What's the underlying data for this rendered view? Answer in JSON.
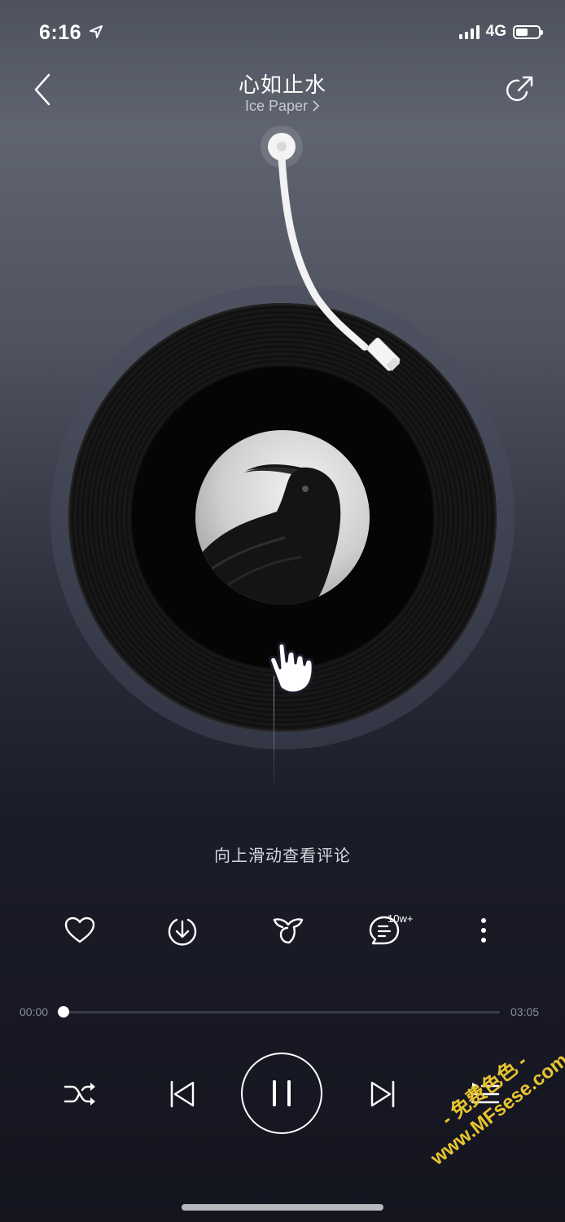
{
  "status_bar": {
    "time": "6:16",
    "network": "4G",
    "battery_level": 0.55
  },
  "header": {
    "title": "心如止水",
    "artist": "Ice Paper"
  },
  "hint": "向上滑动查看评论",
  "actions": {
    "comment_count": "10w+"
  },
  "progress": {
    "current": "00:00",
    "total": "03:05",
    "fraction": 0.0
  },
  "watermark": {
    "line1": "- 免费色色 -",
    "line2": "www.MFsese.com"
  },
  "icons": {
    "back": "chevron-left-icon",
    "share": "share-icon",
    "location": "location-arrow-icon",
    "like": "heart-icon",
    "download": "download-icon",
    "effect": "sound-effect-icon",
    "comment": "comment-icon",
    "more": "more-vertical-icon",
    "shuffle": "shuffle-icon",
    "prev": "previous-icon",
    "pause": "pause-icon",
    "next": "next-icon",
    "playlist": "playlist-icon"
  }
}
